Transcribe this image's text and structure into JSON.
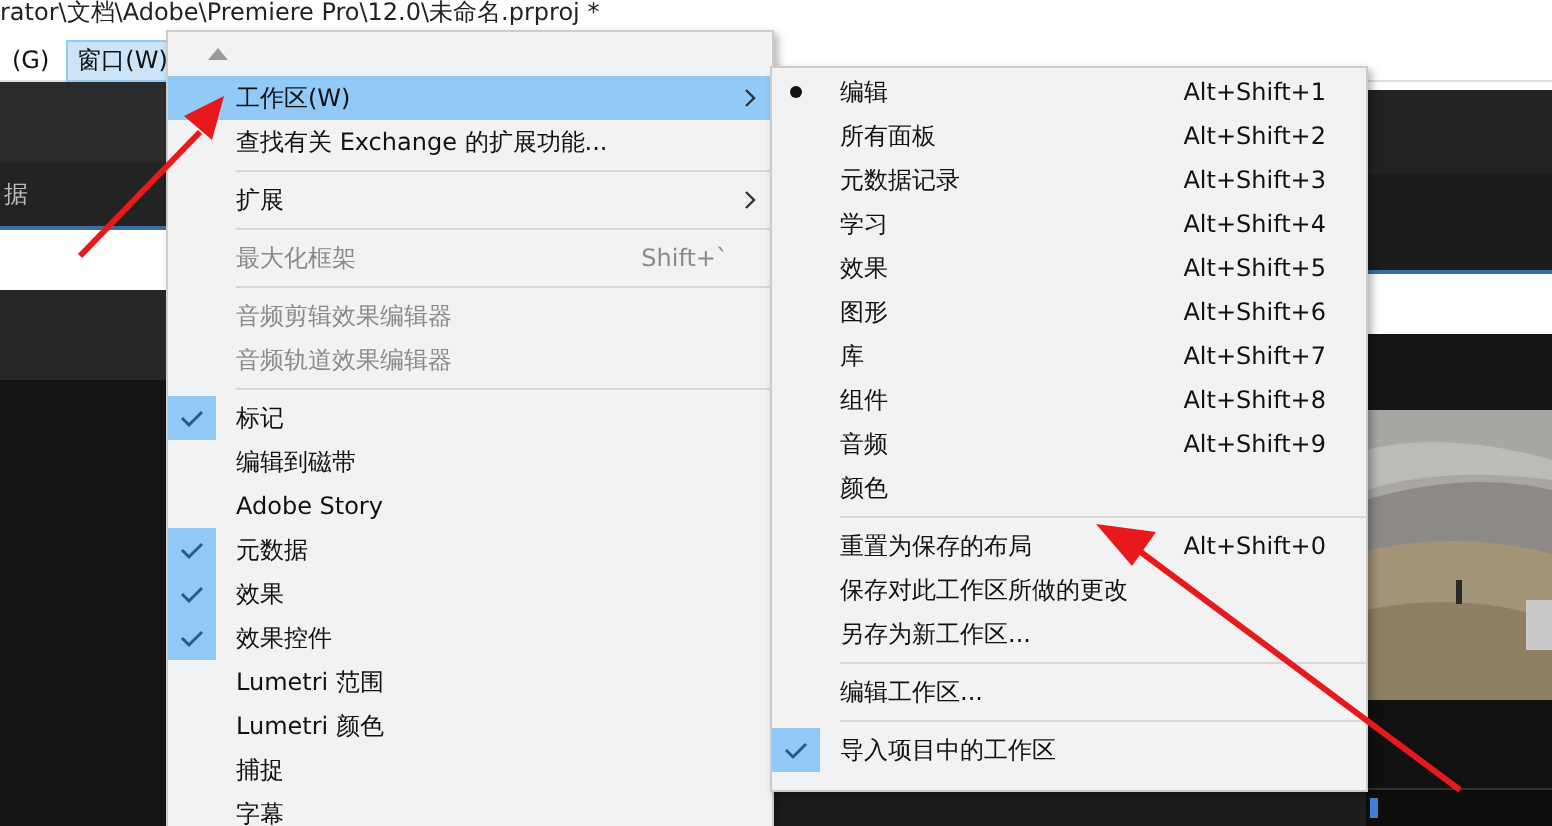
{
  "title_path": "rator\\文档\\Adobe\\Premiere Pro\\12.0\\未命名.prproj *",
  "menubar": [
    {
      "label": "(G)",
      "selected": false
    },
    {
      "label": "窗口(W)",
      "selected": true
    }
  ],
  "panel_label": "据",
  "menu": {
    "items": [
      {
        "kind": "item",
        "label": "工作区(W)",
        "submenu": true,
        "selected": true
      },
      {
        "kind": "item",
        "label": "查找有关 Exchange 的扩展功能...",
        "selected": false
      },
      {
        "kind": "separator"
      },
      {
        "kind": "item",
        "label": "扩展",
        "submenu": true,
        "selected": false
      },
      {
        "kind": "separator"
      },
      {
        "kind": "item",
        "label": "最大化框架",
        "shortcut": "Shift+`",
        "disabled": true,
        "selected": false
      },
      {
        "kind": "separator"
      },
      {
        "kind": "item",
        "label": "音频剪辑效果编辑器",
        "disabled": true,
        "selected": false
      },
      {
        "kind": "item",
        "label": "音频轨道效果编辑器",
        "disabled": true,
        "selected": false
      },
      {
        "kind": "separator"
      },
      {
        "kind": "item",
        "label": "标记",
        "checked": true,
        "selected": false
      },
      {
        "kind": "item",
        "label": "编辑到磁带",
        "checked": false,
        "selected": false
      },
      {
        "kind": "item",
        "label": "Adobe Story",
        "checked": false,
        "selected": false
      },
      {
        "kind": "item",
        "label": "元数据",
        "checked": true,
        "selected": false
      },
      {
        "kind": "item",
        "label": "效果",
        "checked": true,
        "selected": false
      },
      {
        "kind": "item",
        "label": "效果控件",
        "checked": true,
        "selected": false
      },
      {
        "kind": "item",
        "label": "Lumetri 范围",
        "checked": false,
        "selected": false
      },
      {
        "kind": "item",
        "label": "Lumetri 颜色",
        "checked": false,
        "selected": false
      },
      {
        "kind": "item",
        "label": "捕捉",
        "checked": false,
        "selected": false
      },
      {
        "kind": "item",
        "label": "字幕",
        "checked": false,
        "selected": false
      }
    ]
  },
  "submenu": {
    "items": [
      {
        "kind": "radio",
        "label": "编辑",
        "shortcut": "Alt+Shift+1",
        "on": true
      },
      {
        "kind": "radio",
        "label": "所有面板",
        "shortcut": "Alt+Shift+2",
        "on": false
      },
      {
        "kind": "radio",
        "label": "元数据记录",
        "shortcut": "Alt+Shift+3",
        "on": false
      },
      {
        "kind": "radio",
        "label": "学习",
        "shortcut": "Alt+Shift+4",
        "on": false
      },
      {
        "kind": "radio",
        "label": "效果",
        "shortcut": "Alt+Shift+5",
        "on": false
      },
      {
        "kind": "radio",
        "label": "图形",
        "shortcut": "Alt+Shift+6",
        "on": false
      },
      {
        "kind": "radio",
        "label": "库",
        "shortcut": "Alt+Shift+7",
        "on": false
      },
      {
        "kind": "radio",
        "label": "组件",
        "shortcut": "Alt+Shift+8",
        "on": false
      },
      {
        "kind": "radio",
        "label": "音频",
        "shortcut": "Alt+Shift+9",
        "on": false
      },
      {
        "kind": "radio",
        "label": "颜色",
        "on": false
      },
      {
        "kind": "separator"
      },
      {
        "kind": "item",
        "label": "重置为保存的布局",
        "shortcut": "Alt+Shift+0"
      },
      {
        "kind": "item",
        "label": "保存对此工作区所做的更改"
      },
      {
        "kind": "item",
        "label": "另存为新工作区..."
      },
      {
        "kind": "separator"
      },
      {
        "kind": "item",
        "label": "编辑工作区..."
      },
      {
        "kind": "separator"
      },
      {
        "kind": "check",
        "label": "导入项目中的工作区",
        "checked": true
      }
    ]
  }
}
